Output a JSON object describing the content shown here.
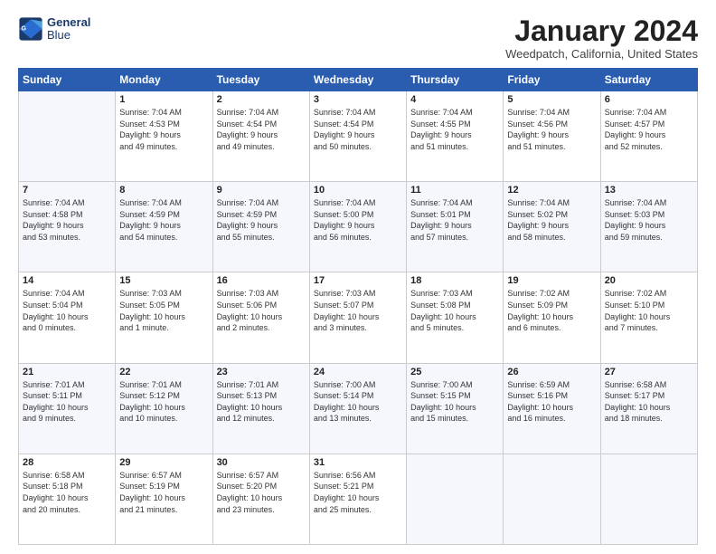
{
  "header": {
    "logo_line1": "General",
    "logo_line2": "Blue",
    "month_title": "January 2024",
    "location": "Weedpatch, California, United States"
  },
  "days_of_week": [
    "Sunday",
    "Monday",
    "Tuesday",
    "Wednesday",
    "Thursday",
    "Friday",
    "Saturday"
  ],
  "weeks": [
    [
      {
        "day": "",
        "text": ""
      },
      {
        "day": "1",
        "text": "Sunrise: 7:04 AM\nSunset: 4:53 PM\nDaylight: 9 hours\nand 49 minutes."
      },
      {
        "day": "2",
        "text": "Sunrise: 7:04 AM\nSunset: 4:54 PM\nDaylight: 9 hours\nand 49 minutes."
      },
      {
        "day": "3",
        "text": "Sunrise: 7:04 AM\nSunset: 4:54 PM\nDaylight: 9 hours\nand 50 minutes."
      },
      {
        "day": "4",
        "text": "Sunrise: 7:04 AM\nSunset: 4:55 PM\nDaylight: 9 hours\nand 51 minutes."
      },
      {
        "day": "5",
        "text": "Sunrise: 7:04 AM\nSunset: 4:56 PM\nDaylight: 9 hours\nand 51 minutes."
      },
      {
        "day": "6",
        "text": "Sunrise: 7:04 AM\nSunset: 4:57 PM\nDaylight: 9 hours\nand 52 minutes."
      }
    ],
    [
      {
        "day": "7",
        "text": "Sunrise: 7:04 AM\nSunset: 4:58 PM\nDaylight: 9 hours\nand 53 minutes."
      },
      {
        "day": "8",
        "text": "Sunrise: 7:04 AM\nSunset: 4:59 PM\nDaylight: 9 hours\nand 54 minutes."
      },
      {
        "day": "9",
        "text": "Sunrise: 7:04 AM\nSunset: 4:59 PM\nDaylight: 9 hours\nand 55 minutes."
      },
      {
        "day": "10",
        "text": "Sunrise: 7:04 AM\nSunset: 5:00 PM\nDaylight: 9 hours\nand 56 minutes."
      },
      {
        "day": "11",
        "text": "Sunrise: 7:04 AM\nSunset: 5:01 PM\nDaylight: 9 hours\nand 57 minutes."
      },
      {
        "day": "12",
        "text": "Sunrise: 7:04 AM\nSunset: 5:02 PM\nDaylight: 9 hours\nand 58 minutes."
      },
      {
        "day": "13",
        "text": "Sunrise: 7:04 AM\nSunset: 5:03 PM\nDaylight: 9 hours\nand 59 minutes."
      }
    ],
    [
      {
        "day": "14",
        "text": "Sunrise: 7:04 AM\nSunset: 5:04 PM\nDaylight: 10 hours\nand 0 minutes."
      },
      {
        "day": "15",
        "text": "Sunrise: 7:03 AM\nSunset: 5:05 PM\nDaylight: 10 hours\nand 1 minute."
      },
      {
        "day": "16",
        "text": "Sunrise: 7:03 AM\nSunset: 5:06 PM\nDaylight: 10 hours\nand 2 minutes."
      },
      {
        "day": "17",
        "text": "Sunrise: 7:03 AM\nSunset: 5:07 PM\nDaylight: 10 hours\nand 3 minutes."
      },
      {
        "day": "18",
        "text": "Sunrise: 7:03 AM\nSunset: 5:08 PM\nDaylight: 10 hours\nand 5 minutes."
      },
      {
        "day": "19",
        "text": "Sunrise: 7:02 AM\nSunset: 5:09 PM\nDaylight: 10 hours\nand 6 minutes."
      },
      {
        "day": "20",
        "text": "Sunrise: 7:02 AM\nSunset: 5:10 PM\nDaylight: 10 hours\nand 7 minutes."
      }
    ],
    [
      {
        "day": "21",
        "text": "Sunrise: 7:01 AM\nSunset: 5:11 PM\nDaylight: 10 hours\nand 9 minutes."
      },
      {
        "day": "22",
        "text": "Sunrise: 7:01 AM\nSunset: 5:12 PM\nDaylight: 10 hours\nand 10 minutes."
      },
      {
        "day": "23",
        "text": "Sunrise: 7:01 AM\nSunset: 5:13 PM\nDaylight: 10 hours\nand 12 minutes."
      },
      {
        "day": "24",
        "text": "Sunrise: 7:00 AM\nSunset: 5:14 PM\nDaylight: 10 hours\nand 13 minutes."
      },
      {
        "day": "25",
        "text": "Sunrise: 7:00 AM\nSunset: 5:15 PM\nDaylight: 10 hours\nand 15 minutes."
      },
      {
        "day": "26",
        "text": "Sunrise: 6:59 AM\nSunset: 5:16 PM\nDaylight: 10 hours\nand 16 minutes."
      },
      {
        "day": "27",
        "text": "Sunrise: 6:58 AM\nSunset: 5:17 PM\nDaylight: 10 hours\nand 18 minutes."
      }
    ],
    [
      {
        "day": "28",
        "text": "Sunrise: 6:58 AM\nSunset: 5:18 PM\nDaylight: 10 hours\nand 20 minutes."
      },
      {
        "day": "29",
        "text": "Sunrise: 6:57 AM\nSunset: 5:19 PM\nDaylight: 10 hours\nand 21 minutes."
      },
      {
        "day": "30",
        "text": "Sunrise: 6:57 AM\nSunset: 5:20 PM\nDaylight: 10 hours\nand 23 minutes."
      },
      {
        "day": "31",
        "text": "Sunrise: 6:56 AM\nSunset: 5:21 PM\nDaylight: 10 hours\nand 25 minutes."
      },
      {
        "day": "",
        "text": ""
      },
      {
        "day": "",
        "text": ""
      },
      {
        "day": "",
        "text": ""
      }
    ]
  ]
}
